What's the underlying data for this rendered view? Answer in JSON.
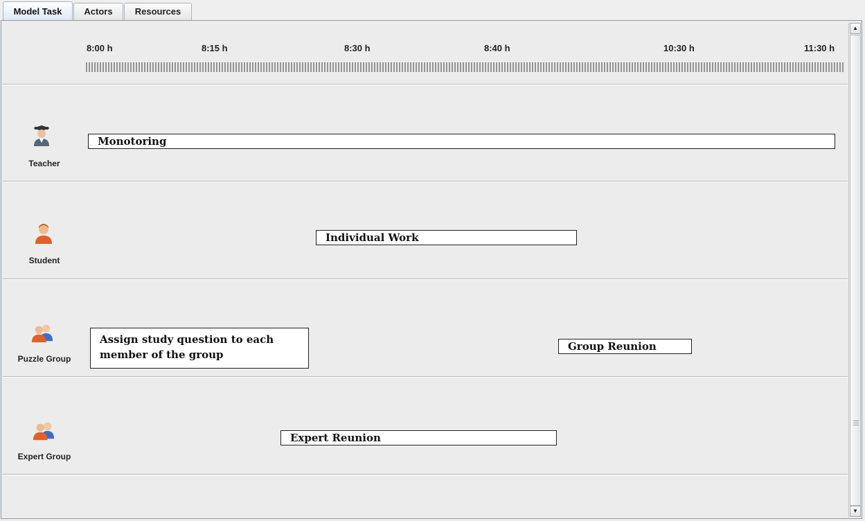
{
  "tabs": [
    {
      "label": "Model Task",
      "active": true
    },
    {
      "label": "Actors",
      "active": false
    },
    {
      "label": "Resources",
      "active": false
    }
  ],
  "timeline": {
    "labels": [
      "8:00 h",
      "8:15 h",
      "8:30 h",
      "8:40 h",
      "10:30 h",
      "11:30 h"
    ]
  },
  "lanes": [
    {
      "actor": "Teacher",
      "icon": "teacher-icon",
      "tasks": [
        {
          "label": "Monotoring"
        }
      ]
    },
    {
      "actor": "Student",
      "icon": "student-icon",
      "tasks": [
        {
          "label": "Individual Work"
        }
      ]
    },
    {
      "actor": "Puzzle Group",
      "icon": "group-icon",
      "tasks": [
        {
          "label": "Assign study question to each member of the group"
        },
        {
          "label": "Group Reunion"
        }
      ]
    },
    {
      "actor": "Expert Group",
      "icon": "group-icon",
      "tasks": [
        {
          "label": "Expert Reunion"
        }
      ]
    }
  ],
  "colors": {
    "accent": "#dde7f2",
    "lane_bg": "#ececec",
    "task_border": "#222222"
  }
}
